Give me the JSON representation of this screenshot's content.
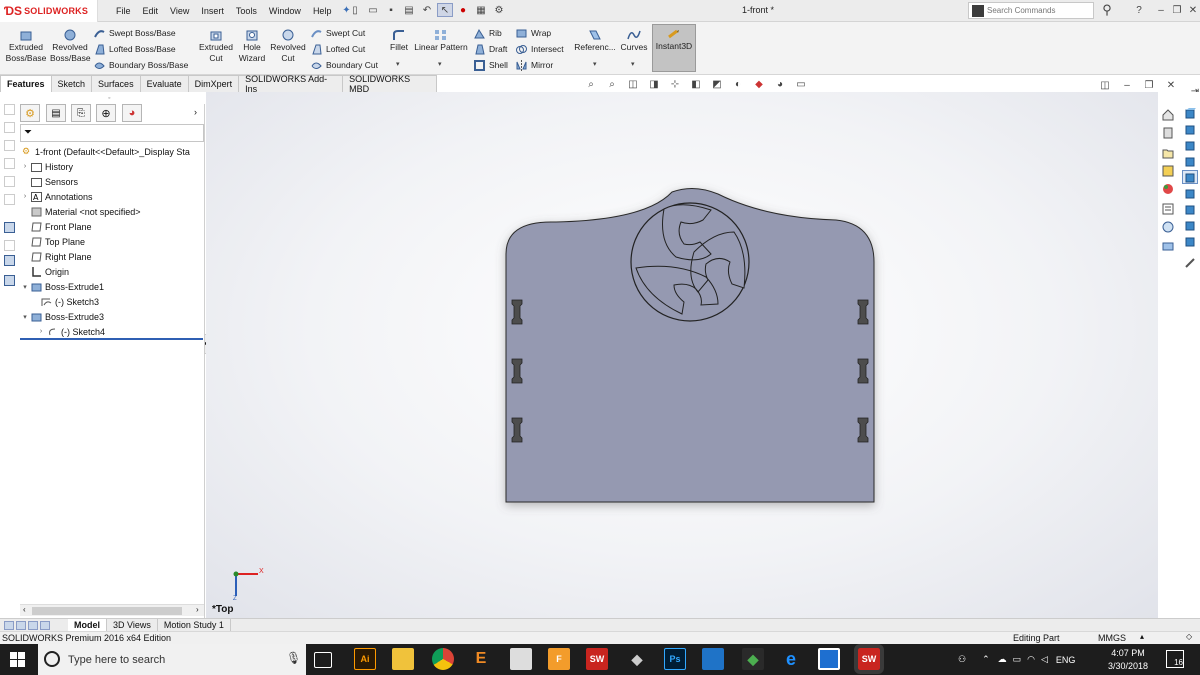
{
  "app": {
    "brand": "SOLIDWORKS",
    "document_title": "1-front *"
  },
  "menu": [
    "File",
    "Edit",
    "View",
    "Insert",
    "Tools",
    "Window",
    "Help"
  ],
  "search": {
    "placeholder": "Search Commands"
  },
  "ribbon": {
    "extruded_boss": [
      "Extruded",
      "Boss/Base"
    ],
    "revolved_boss": [
      "Revolved",
      "Boss/Base"
    ],
    "swept_boss": "Swept Boss/Base",
    "lofted_boss": "Lofted Boss/Base",
    "boundary_boss": "Boundary Boss/Base",
    "extruded_cut": [
      "Extruded",
      "Cut"
    ],
    "hole_wizard": [
      "Hole",
      "Wizard"
    ],
    "revolved_cut": [
      "Revolved",
      "Cut"
    ],
    "swept_cut": "Swept Cut",
    "lofted_cut": "Lofted Cut",
    "boundary_cut": "Boundary Cut",
    "fillet": "Fillet",
    "linear_pattern": "Linear Pattern",
    "rib": "Rib",
    "draft": "Draft",
    "shell": "Shell",
    "wrap": "Wrap",
    "intersect": "Intersect",
    "mirror": "Mirror",
    "reference": "Referenc...",
    "curves": "Curves",
    "instant3d": "Instant3D"
  },
  "command_tabs": [
    "Features",
    "Sketch",
    "Surfaces",
    "Evaluate",
    "DimXpert",
    "SOLIDWORKS Add-Ins",
    "SOLIDWORKS MBD"
  ],
  "tree": {
    "root": "1-front  (Default<<Default>_Display Sta",
    "items": [
      {
        "label": "History",
        "icon": "folder-icon"
      },
      {
        "label": "Sensors",
        "icon": "sensor-icon"
      },
      {
        "label": "Annotations",
        "icon": "annotation-icon"
      },
      {
        "label": "Material <not specified>",
        "icon": "material-icon"
      },
      {
        "label": "Front Plane",
        "icon": "plane-icon"
      },
      {
        "label": "Top Plane",
        "icon": "plane-icon"
      },
      {
        "label": "Right Plane",
        "icon": "plane-icon"
      },
      {
        "label": "Origin",
        "icon": "origin-icon"
      },
      {
        "label": "Boss-Extrude1",
        "icon": "extrude-icon"
      },
      {
        "label": "(-) Sketch3",
        "icon": "sketch-icon"
      },
      {
        "label": "Boss-Extrude3",
        "icon": "extrude-icon"
      },
      {
        "label": "(-) Sketch4",
        "icon": "sketch-icon"
      }
    ]
  },
  "viewport": {
    "view_label": "*Top",
    "axis_x": "X",
    "axis_z": "Z"
  },
  "bottom_tabs": [
    "Model",
    "3D Views",
    "Motion Study 1"
  ],
  "status": {
    "edition": "SOLIDWORKS Premium 2016 x64 Edition",
    "mode": "Editing Part",
    "units": "MMGS"
  },
  "taskbar": {
    "search_placeholder": "Type here to search",
    "lang": "ENG",
    "time": "4:07 PM",
    "date": "3/30/2018",
    "notif_count": "16"
  },
  "colors": {
    "part_fill": "#9599b1",
    "slot_fill": "#4d4d4d",
    "accent_red": "#d22222",
    "taskbar": "#1d1d1d"
  }
}
